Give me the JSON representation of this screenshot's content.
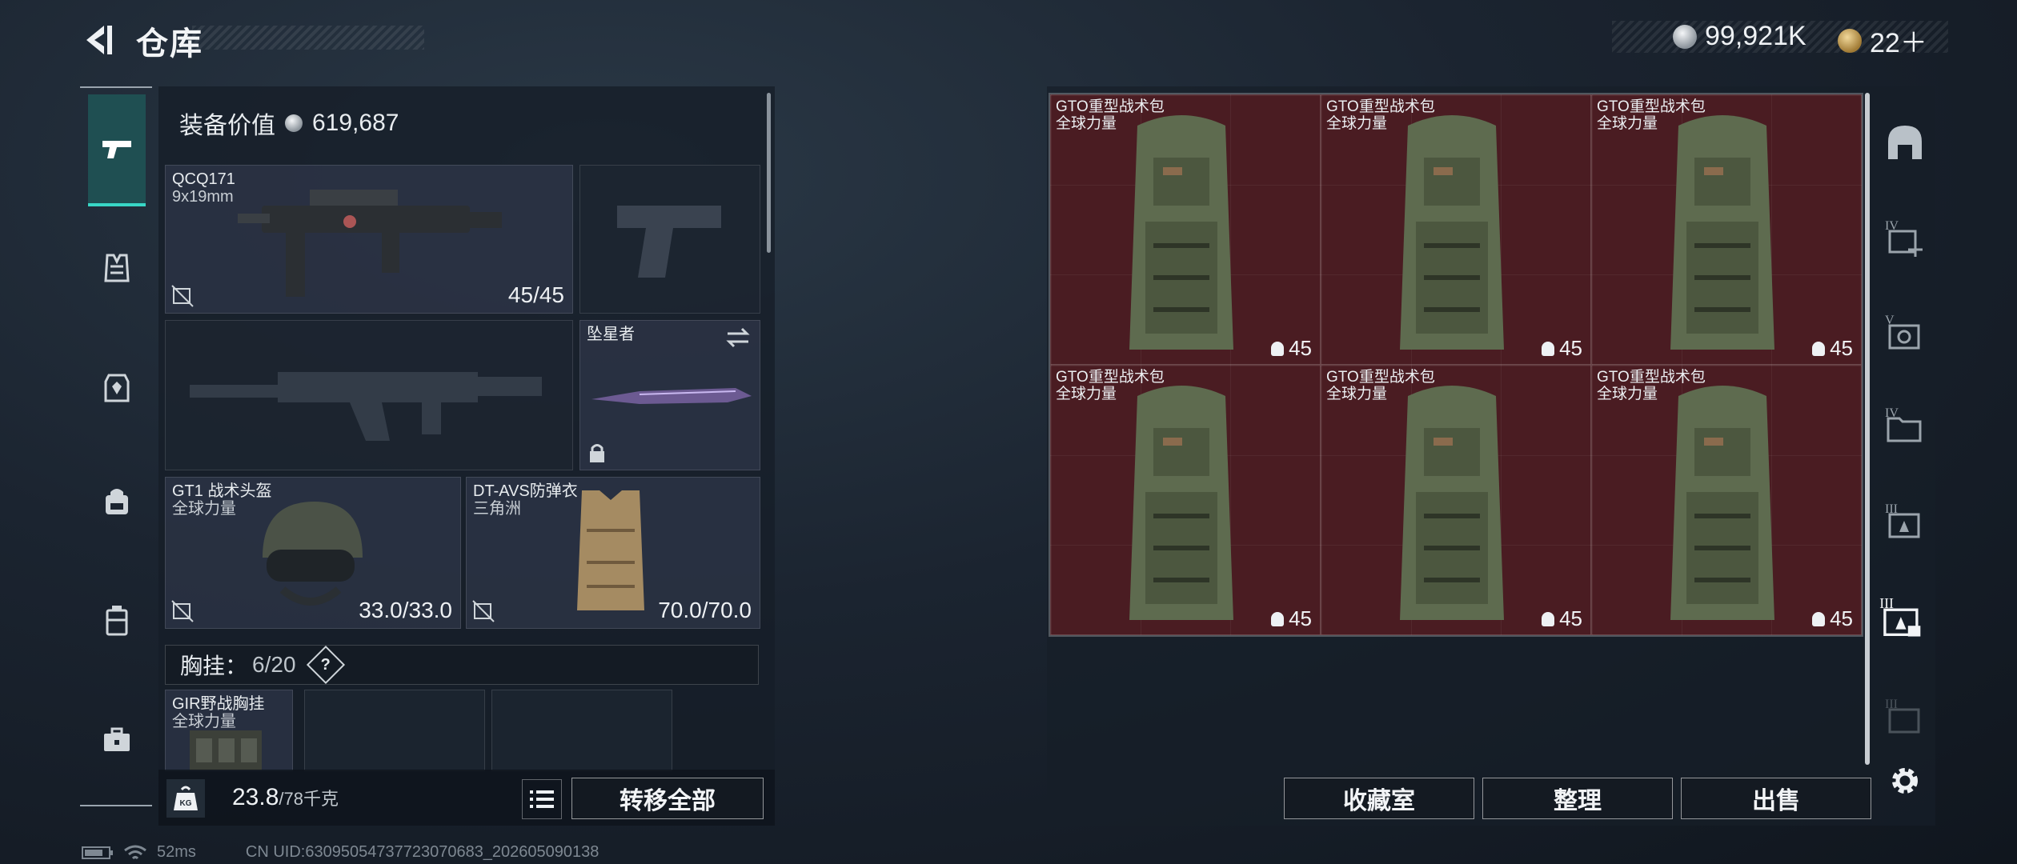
{
  "header": {
    "title": "仓库",
    "silver": "99,921K",
    "gold": "22＋"
  },
  "equipment": {
    "value_label": "装备价值",
    "value": "619,687",
    "primary": {
      "name": "QCQ171",
      "ammo": "9x19mm",
      "durability": "45/45"
    },
    "melee": {
      "name": "坠星者"
    },
    "helmet": {
      "name": "GT1 战术头盔",
      "brand": "全球力量",
      "durability": "33.0/33.0"
    },
    "armor": {
      "name": "DT-AVS防弹衣",
      "brand": "三角洲",
      "durability": "70.0/70.0"
    },
    "vest": {
      "label": "胸挂：",
      "count": "6/20",
      "help": "?",
      "item_name": "GIR野战胸挂",
      "item_brand": "全球力量"
    }
  },
  "weight": {
    "current": "23.8",
    "max": "/78千克",
    "icon": "KG"
  },
  "buttons": {
    "transfer_all": "转移全部",
    "collection": "收藏室",
    "organize": "整理",
    "sell": "出售"
  },
  "storage": {
    "items": [
      {
        "name": "GTO重型战术包",
        "brand": "全球力量",
        "qty": "45"
      },
      {
        "name": "GTO重型战术包",
        "brand": "全球力量",
        "qty": "45"
      },
      {
        "name": "GTO重型战术包",
        "brand": "全球力量",
        "qty": "45"
      },
      {
        "name": "GTO重型战术包",
        "brand": "全球力量",
        "qty": "45"
      },
      {
        "name": "GTO重型战术包",
        "brand": "全球力量",
        "qty": "45"
      },
      {
        "name": "GTO重型战术包",
        "brand": "全球力量",
        "qty": "45"
      }
    ]
  },
  "status": {
    "ping": "52ms",
    "uid": "CN UID:63095054737723070683_202605090138"
  },
  "icons": {
    "left_rail": [
      "pistol-icon",
      "vest-icon",
      "armor-icon",
      "backpack-icon",
      "case-icon",
      "toolbox-icon"
    ],
    "right_rail": [
      "dome-icon",
      "tier4-add-icon",
      "tier5-icon",
      "tier4-folder-icon",
      "tier3-icon",
      "tier3-active-icon",
      "tier3-faded-icon",
      "gear-icon"
    ]
  },
  "colors": {
    "accent": "#38d7c6",
    "storage_cell": "#4a1c22"
  }
}
